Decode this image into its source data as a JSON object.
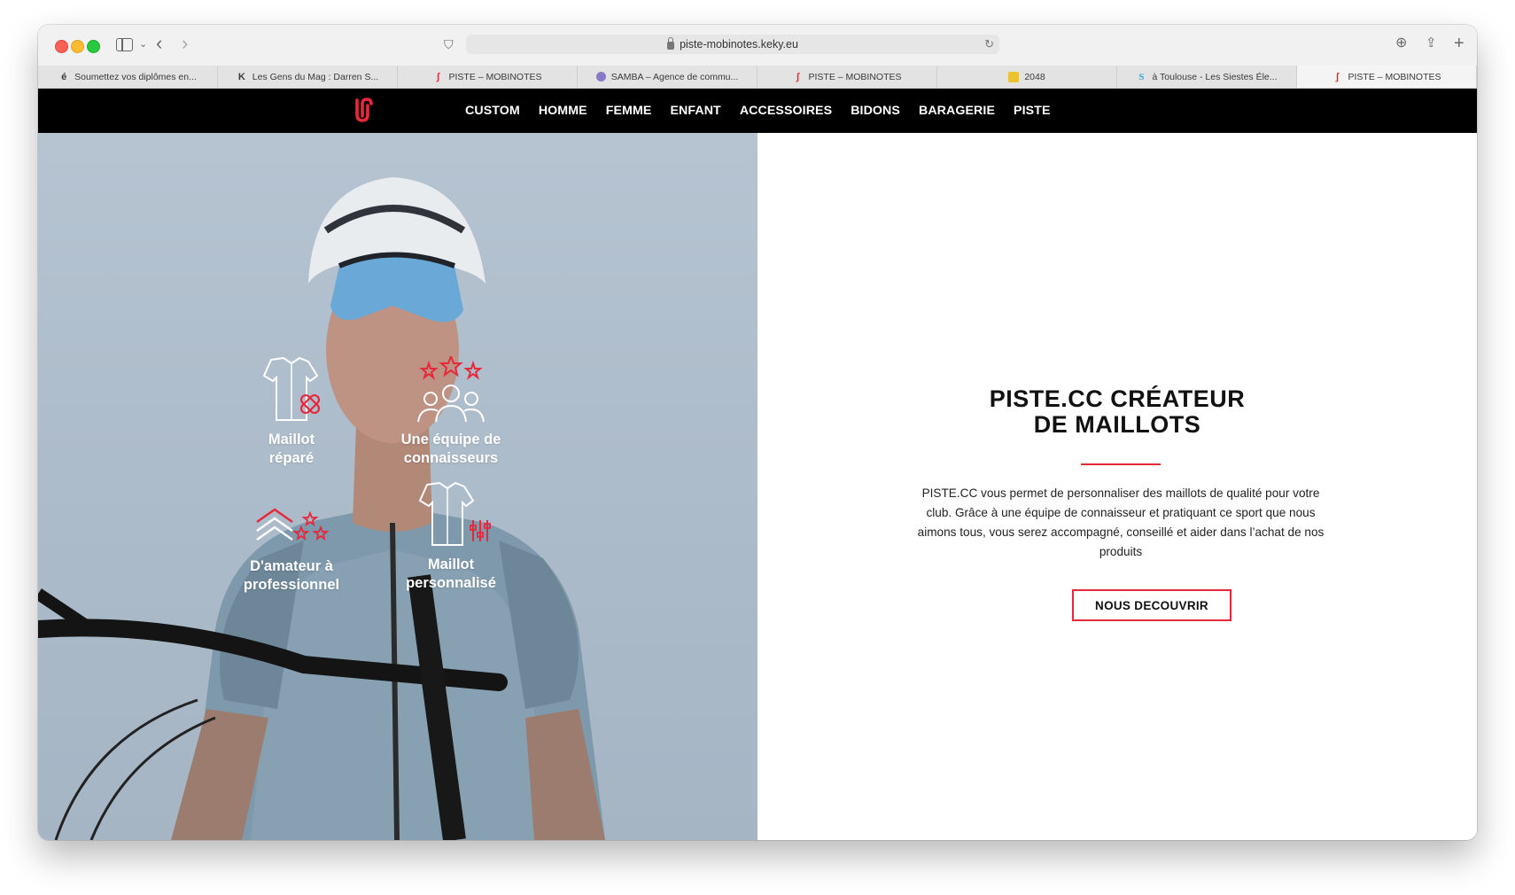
{
  "browser": {
    "url": "piste-mobinotes.keky.eu",
    "tabs": [
      {
        "label": "Soumettez vos diplômes en...",
        "favicon": "é"
      },
      {
        "label": "Les Gens du Mag : Darren S...",
        "favicon": "K"
      },
      {
        "label": "PISTE – MOBINOTES",
        "favicon": "piste-logo"
      },
      {
        "label": "SAMBA – Agence de commu...",
        "favicon": "brain"
      },
      {
        "label": "PISTE – MOBINOTES",
        "favicon": "piste-logo"
      },
      {
        "label": "2048",
        "favicon": "2048"
      },
      {
        "label": "à Toulouse - Les Siestes Éle...",
        "favicon": "S"
      },
      {
        "label": "PISTE – MOBINOTES",
        "favicon": "piste-logo",
        "active": true
      }
    ]
  },
  "nav": {
    "items": [
      "CUSTOM",
      "HOMME",
      "FEMME",
      "ENFANT",
      "ACCESSOIRES",
      "BIDONS",
      "BARAGERIE",
      "PISTE"
    ]
  },
  "hero": {
    "features": [
      {
        "line1": "Maillot",
        "line2": "réparé",
        "icon": "repaired-jersey-icon"
      },
      {
        "line1": "Une équipe de",
        "line2": "connaisseurs",
        "icon": "team-stars-icon"
      },
      {
        "line1": "D'amateur à",
        "line2": "professionnel",
        "icon": "rank-chevron-icon"
      },
      {
        "line1": "Maillot",
        "line2": "personnalisé",
        "icon": "custom-jersey-icon"
      }
    ]
  },
  "panel": {
    "title_line1": "PISTE.CC CRÉATEUR",
    "title_line2": "DE MAILLOTS",
    "text": "PISTE.CC vous permet de personnaliser des maillots de qualité pour votre club. Grâce à une équipe de connaisseur et pratiquant ce sport que nous aimons tous, vous serez accompagné, conseillé et aider dans l’achat de nos produits",
    "cta": "NOUS DECOUVRIR"
  },
  "colors": {
    "accent": "#e5293b",
    "nav_bg": "#000000",
    "hero_tint": "#a9b9c8"
  }
}
